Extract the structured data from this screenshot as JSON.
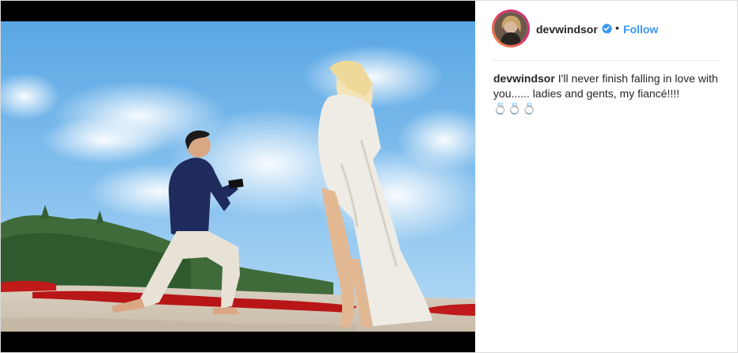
{
  "post": {
    "image_alt": "Man kneeling on beach proposing to woman in white lace gown",
    "author": {
      "username": "devwindsor",
      "verified": true,
      "follow_label": "Follow",
      "separator": "•"
    },
    "caption": {
      "username": "devwindsor",
      "text": "I'll never finish falling in love with you...... ladies and gents, my fiancé!!!!",
      "emojis": "💍💍💍"
    }
  },
  "colors": {
    "follow": "#3897f0",
    "verified": "#3897f0",
    "text": "#262626",
    "border": "#dbdbdb"
  }
}
